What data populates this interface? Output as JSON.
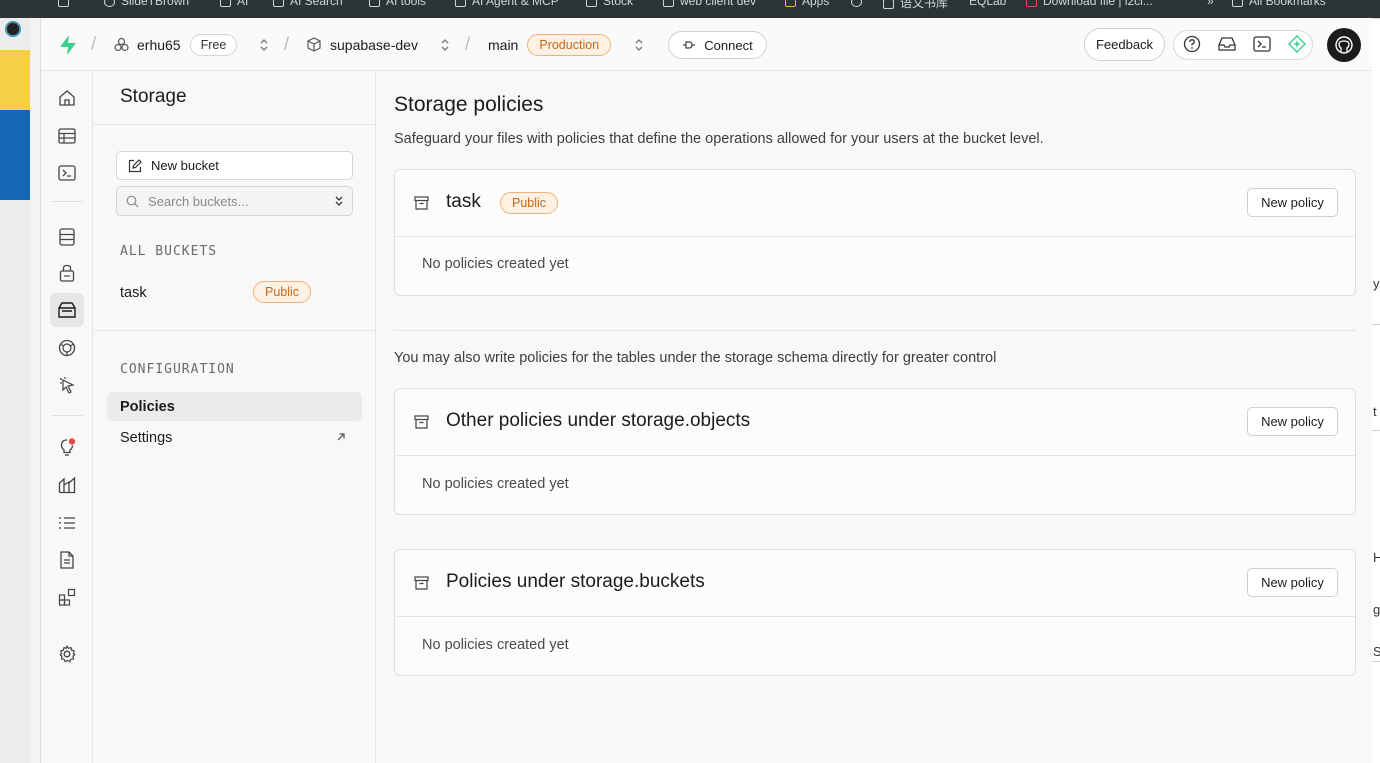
{
  "browser_bookmarks": [
    "SlideTBrown",
    "AI",
    "AI Search",
    "AI tools",
    "AI Agent & MCP",
    "Stock",
    "web client dev",
    "Apps",
    "语文书库",
    "EQLab",
    "Download file | i2ci...",
    "»",
    "All Bookmarks"
  ],
  "topbar": {
    "org_name": "erhu65",
    "org_plan": "Free",
    "project_name": "supabase-dev",
    "branch_name": "main",
    "branch_env": "Production",
    "connect_label": "Connect",
    "feedback_label": "Feedback"
  },
  "storage_panel": {
    "title": "Storage",
    "new_bucket_label": "New bucket",
    "search_placeholder": "Search buckets...",
    "all_buckets_label": "ALL BUCKETS",
    "buckets": [
      {
        "name": "task",
        "badge": "Public"
      }
    ],
    "configuration_label": "CONFIGURATION",
    "config_items": [
      {
        "label": "Policies",
        "active": true
      },
      {
        "label": "Settings",
        "active": false
      }
    ]
  },
  "main": {
    "title": "Storage policies",
    "description": "Safeguard your files with policies that define the operations allowed for your users at the bucket level.",
    "note": "You may also write policies for the tables under the storage schema directly for greater control",
    "cards": [
      {
        "title": "task",
        "badge": "Public",
        "button": "New policy",
        "empty": "No policies created yet"
      },
      {
        "title": "Other policies under storage.objects",
        "badge": "",
        "button": "New policy",
        "empty": "No policies created yet"
      },
      {
        "title": "Policies under storage.buckets",
        "badge": "",
        "button": "New policy",
        "empty": "No policies created yet"
      }
    ]
  },
  "right_strip_glyphs": [
    "y",
    "t",
    "H",
    "g",
    "S"
  ],
  "colors": {
    "brand_green": "#3ecf8e",
    "public_badge_text": "#c2691a",
    "public_badge_bg": "#fdf1e4",
    "notification_dot": "#e5484d"
  }
}
